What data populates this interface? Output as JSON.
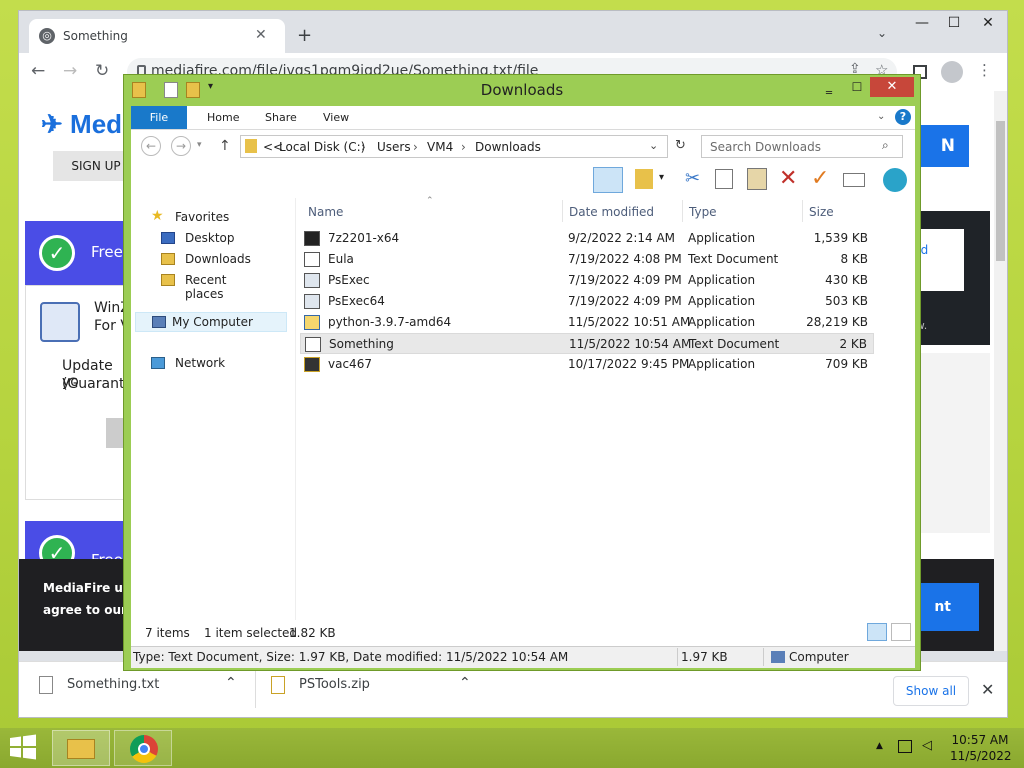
{
  "browser": {
    "tab_title": "Something",
    "url": "mediafire.com/file/ivqs1pqm9iqd2ue/Something.txt/file",
    "page": {
      "logo": "MediaFire",
      "signup": "SIGN UP",
      "card1_label": "Free",
      "card2_label": "Free",
      "winz": "WinZ",
      "forw": "For V",
      "update": "Update yo",
      "guarantee": "(Guarante",
      "download_link": "nload",
      "now": "ow.",
      "n_button": "N",
      "t_button": "nt",
      "notice_1": "MediaFire use",
      "notice_2": "agree to our F"
    },
    "downloads": [
      {
        "name": "Something.txt"
      },
      {
        "name": "PSTools.zip"
      }
    ],
    "show_all": "Show all"
  },
  "explorer": {
    "title": "Downloads",
    "ribbon_tabs": [
      "File",
      "Home",
      "Share",
      "View"
    ],
    "breadcrumb": [
      "<<",
      "Local Disk (C:)",
      "Users",
      "VM4",
      "Downloads"
    ],
    "search_placeholder": "Search Downloads",
    "nav": {
      "favorites": "Favorites",
      "fav_items": [
        "Desktop",
        "Downloads",
        "Recent places"
      ],
      "my_computer": "My Computer",
      "network": "Network"
    },
    "columns": [
      "Name",
      "Date modified",
      "Type",
      "Size"
    ],
    "files": [
      {
        "name": "7z2201-x64",
        "date": "9/2/2022 2:14 AM",
        "type": "Application",
        "size": "1,539 KB"
      },
      {
        "name": "Eula",
        "date": "7/19/2022 4:08 PM",
        "type": "Text Document",
        "size": "8 KB"
      },
      {
        "name": "PsExec",
        "date": "7/19/2022 4:09 PM",
        "type": "Application",
        "size": "430 KB"
      },
      {
        "name": "PsExec64",
        "date": "7/19/2022 4:09 PM",
        "type": "Application",
        "size": "503 KB"
      },
      {
        "name": "python-3.9.7-amd64",
        "date": "11/5/2022 10:51 AM",
        "type": "Application",
        "size": "28,219 KB"
      },
      {
        "name": "Something",
        "date": "11/5/2022 10:54 AM",
        "type": "Text Document",
        "size": "2 KB"
      },
      {
        "name": "vac467",
        "date": "10/17/2022 9:45 PM",
        "type": "Application",
        "size": "709 KB"
      }
    ],
    "status": {
      "items": "7 items",
      "selected": "1 item selected",
      "selected_size": "1.82 KB",
      "details": "Type: Text Document, Size: 1.97 KB, Date modified: 11/5/2022 10:54 AM",
      "size": "1.97 KB",
      "location": "Computer"
    }
  },
  "taskbar": {
    "time": "10:57 AM",
    "date": "11/5/2022"
  }
}
